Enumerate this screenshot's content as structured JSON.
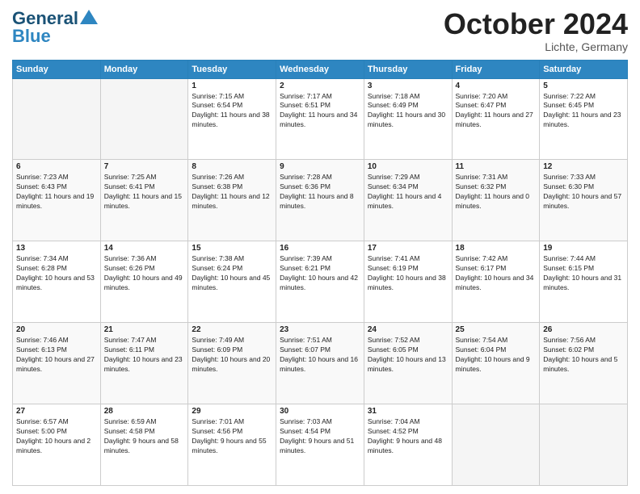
{
  "logo": {
    "line1": "General",
    "line2": "Blue"
  },
  "header": {
    "month": "October 2024",
    "location": "Lichte, Germany"
  },
  "weekdays": [
    "Sunday",
    "Monday",
    "Tuesday",
    "Wednesday",
    "Thursday",
    "Friday",
    "Saturday"
  ],
  "weeks": [
    [
      {
        "day": "",
        "info": ""
      },
      {
        "day": "",
        "info": ""
      },
      {
        "day": "1",
        "info": "Sunrise: 7:15 AM\nSunset: 6:54 PM\nDaylight: 11 hours and 38 minutes."
      },
      {
        "day": "2",
        "info": "Sunrise: 7:17 AM\nSunset: 6:51 PM\nDaylight: 11 hours and 34 minutes."
      },
      {
        "day": "3",
        "info": "Sunrise: 7:18 AM\nSunset: 6:49 PM\nDaylight: 11 hours and 30 minutes."
      },
      {
        "day": "4",
        "info": "Sunrise: 7:20 AM\nSunset: 6:47 PM\nDaylight: 11 hours and 27 minutes."
      },
      {
        "day": "5",
        "info": "Sunrise: 7:22 AM\nSunset: 6:45 PM\nDaylight: 11 hours and 23 minutes."
      }
    ],
    [
      {
        "day": "6",
        "info": "Sunrise: 7:23 AM\nSunset: 6:43 PM\nDaylight: 11 hours and 19 minutes."
      },
      {
        "day": "7",
        "info": "Sunrise: 7:25 AM\nSunset: 6:41 PM\nDaylight: 11 hours and 15 minutes."
      },
      {
        "day": "8",
        "info": "Sunrise: 7:26 AM\nSunset: 6:38 PM\nDaylight: 11 hours and 12 minutes."
      },
      {
        "day": "9",
        "info": "Sunrise: 7:28 AM\nSunset: 6:36 PM\nDaylight: 11 hours and 8 minutes."
      },
      {
        "day": "10",
        "info": "Sunrise: 7:29 AM\nSunset: 6:34 PM\nDaylight: 11 hours and 4 minutes."
      },
      {
        "day": "11",
        "info": "Sunrise: 7:31 AM\nSunset: 6:32 PM\nDaylight: 11 hours and 0 minutes."
      },
      {
        "day": "12",
        "info": "Sunrise: 7:33 AM\nSunset: 6:30 PM\nDaylight: 10 hours and 57 minutes."
      }
    ],
    [
      {
        "day": "13",
        "info": "Sunrise: 7:34 AM\nSunset: 6:28 PM\nDaylight: 10 hours and 53 minutes."
      },
      {
        "day": "14",
        "info": "Sunrise: 7:36 AM\nSunset: 6:26 PM\nDaylight: 10 hours and 49 minutes."
      },
      {
        "day": "15",
        "info": "Sunrise: 7:38 AM\nSunset: 6:24 PM\nDaylight: 10 hours and 45 minutes."
      },
      {
        "day": "16",
        "info": "Sunrise: 7:39 AM\nSunset: 6:21 PM\nDaylight: 10 hours and 42 minutes."
      },
      {
        "day": "17",
        "info": "Sunrise: 7:41 AM\nSunset: 6:19 PM\nDaylight: 10 hours and 38 minutes."
      },
      {
        "day": "18",
        "info": "Sunrise: 7:42 AM\nSunset: 6:17 PM\nDaylight: 10 hours and 34 minutes."
      },
      {
        "day": "19",
        "info": "Sunrise: 7:44 AM\nSunset: 6:15 PM\nDaylight: 10 hours and 31 minutes."
      }
    ],
    [
      {
        "day": "20",
        "info": "Sunrise: 7:46 AM\nSunset: 6:13 PM\nDaylight: 10 hours and 27 minutes."
      },
      {
        "day": "21",
        "info": "Sunrise: 7:47 AM\nSunset: 6:11 PM\nDaylight: 10 hours and 23 minutes."
      },
      {
        "day": "22",
        "info": "Sunrise: 7:49 AM\nSunset: 6:09 PM\nDaylight: 10 hours and 20 minutes."
      },
      {
        "day": "23",
        "info": "Sunrise: 7:51 AM\nSunset: 6:07 PM\nDaylight: 10 hours and 16 minutes."
      },
      {
        "day": "24",
        "info": "Sunrise: 7:52 AM\nSunset: 6:05 PM\nDaylight: 10 hours and 13 minutes."
      },
      {
        "day": "25",
        "info": "Sunrise: 7:54 AM\nSunset: 6:04 PM\nDaylight: 10 hours and 9 minutes."
      },
      {
        "day": "26",
        "info": "Sunrise: 7:56 AM\nSunset: 6:02 PM\nDaylight: 10 hours and 5 minutes."
      }
    ],
    [
      {
        "day": "27",
        "info": "Sunrise: 6:57 AM\nSunset: 5:00 PM\nDaylight: 10 hours and 2 minutes."
      },
      {
        "day": "28",
        "info": "Sunrise: 6:59 AM\nSunset: 4:58 PM\nDaylight: 9 hours and 58 minutes."
      },
      {
        "day": "29",
        "info": "Sunrise: 7:01 AM\nSunset: 4:56 PM\nDaylight: 9 hours and 55 minutes."
      },
      {
        "day": "30",
        "info": "Sunrise: 7:03 AM\nSunset: 4:54 PM\nDaylight: 9 hours and 51 minutes."
      },
      {
        "day": "31",
        "info": "Sunrise: 7:04 AM\nSunset: 4:52 PM\nDaylight: 9 hours and 48 minutes."
      },
      {
        "day": "",
        "info": ""
      },
      {
        "day": "",
        "info": ""
      }
    ]
  ]
}
